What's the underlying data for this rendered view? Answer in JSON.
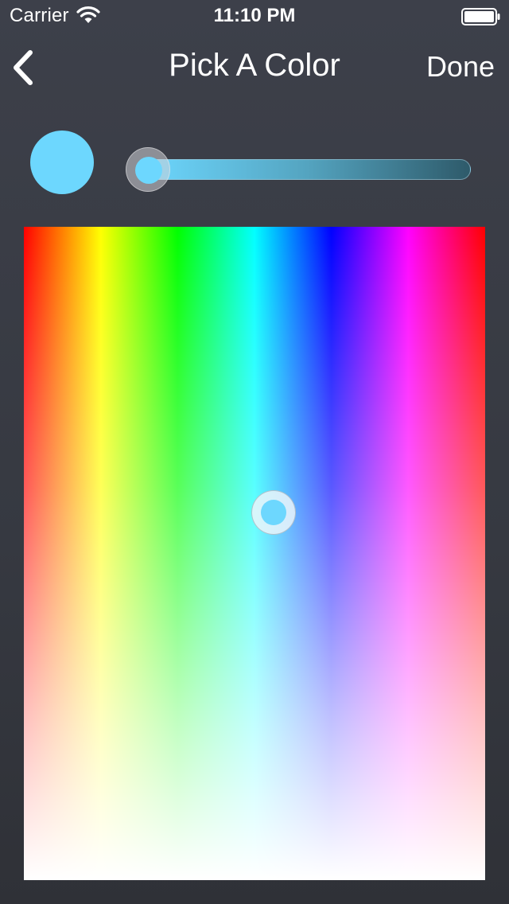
{
  "status_bar": {
    "carrier": "Carrier",
    "time": "11:10 PM",
    "wifi_icon": "wifi-icon",
    "battery_icon": "battery-full-icon"
  },
  "nav": {
    "back_icon": "chevron-left-icon",
    "title": "Pick A Color",
    "done_label": "Done"
  },
  "picker": {
    "selected_color": "#6dd7fe",
    "brightness_level": 0.0,
    "hue_stops": [
      "#ff0000",
      "#ffff00",
      "#00ff00",
      "#00ffff",
      "#0000ff",
      "#ff00ff",
      "#ff0000"
    ]
  },
  "colors": {
    "background": "#3a3d46",
    "text": "#ffffff"
  }
}
